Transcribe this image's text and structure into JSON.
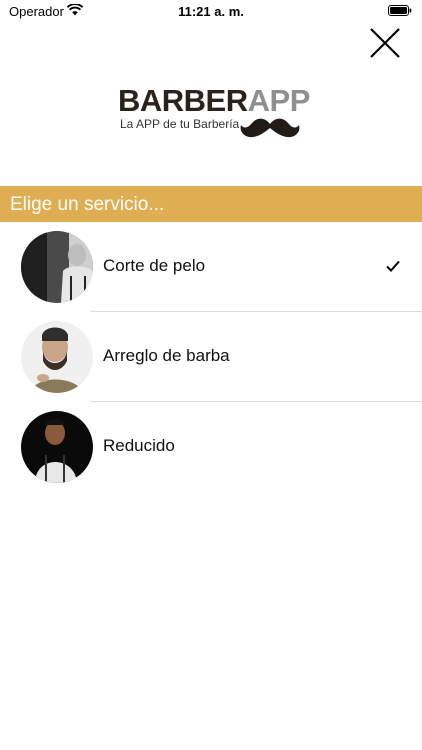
{
  "status_bar": {
    "carrier": "Operador",
    "time": "11:21 a. m."
  },
  "logo": {
    "brand_part1": "BARBER",
    "brand_part2": "APP",
    "tagline": "La APP de tu Barbería"
  },
  "section": {
    "title": "Elige un servicio..."
  },
  "services": [
    {
      "label": "Corte de pelo",
      "selected": true,
      "avatar_icon": "man-haircut-photo"
    },
    {
      "label": "Arreglo de barba",
      "selected": false,
      "avatar_icon": "bearded-man-photo"
    },
    {
      "label": "Reducido",
      "selected": false,
      "avatar_icon": "man-suspenders-photo"
    }
  ],
  "colors": {
    "header_bg": "#dfae52",
    "logo_dark": "#2a221c",
    "logo_gray": "#8f8f8f"
  }
}
